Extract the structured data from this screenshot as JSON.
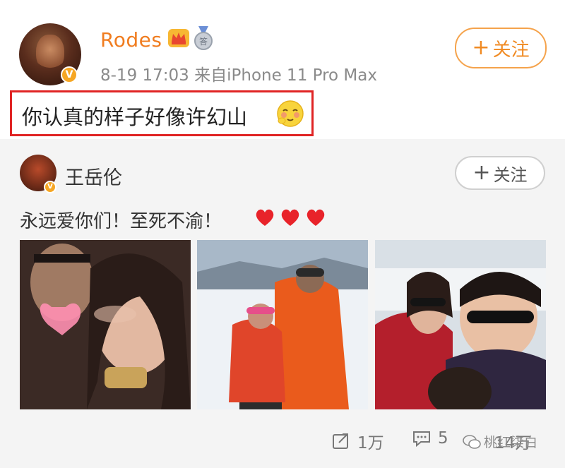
{
  "post": {
    "username": "Rodes",
    "timestamp": "8-19 17:03",
    "source": "来自iPhone 11 Pro Max",
    "follow_label": "关注",
    "text": "你认真的样子好像许幻山",
    "icons": [
      "crown-icon",
      "medal-icon",
      "verified-badge-icon",
      "blush-emoji-icon"
    ]
  },
  "repost": {
    "username": "王岳伦",
    "follow_label": "关注",
    "text": "永远爱你们！至死不渝！",
    "hearts": 3,
    "photos": [
      "photo-1",
      "photo-2",
      "photo-3"
    ]
  },
  "footer": {
    "reposts": "1万",
    "comments": "5",
    "likes": "14万",
    "watermark": "桃红柒白"
  },
  "colors": {
    "username": "#f07c1f",
    "follow_border": "#f5a34c",
    "highlight_box": "#e02424",
    "heart": "#e8232a",
    "verified": "#f6a623"
  }
}
